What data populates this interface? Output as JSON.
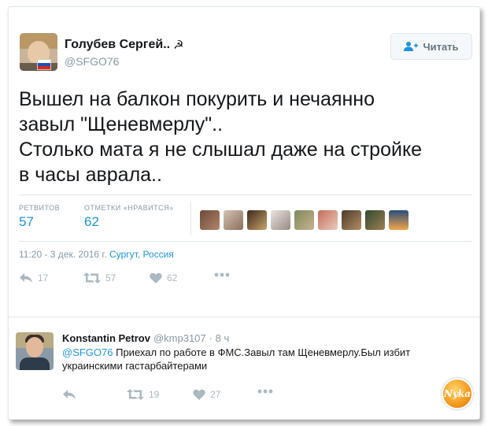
{
  "tweet": {
    "display_name": "Голубев Сергей..",
    "name_emoji": "☭",
    "handle": "@SFGO76",
    "follow_label": "Читать",
    "text": "Вышел на балкон покурить и нечаянно\nзавыл \"Щеневмерлу\"..\nСтолько мата я не слышал даже на стройке\nв часы аврала..",
    "retweets_label": "РЕТВИТОВ",
    "retweets_count": "57",
    "likes_label": "ОТМЕТКИ «НРАВИТСЯ»",
    "likes_count": "62",
    "time": "11:20 - 3 дек. 2016 г.",
    "location": "Сургут, Россия",
    "actions": {
      "reply_count": "17",
      "retweet_count": "57",
      "like_count": "62"
    },
    "colors": {
      "link": "#1b95e0",
      "muted": "#8899a6"
    }
  },
  "reply": {
    "display_name": "Konstantin Petrov",
    "handle": "@kmp3107",
    "time": "· 8 ч",
    "mention": "@SFGO76",
    "text": " Приехал по работе в ФМС.Завыл там Щеневмерлу.Был избит украинскими гастарбайтерами",
    "actions": {
      "retweet_count": "19",
      "like_count": "27"
    }
  },
  "watermark": "Nyka"
}
